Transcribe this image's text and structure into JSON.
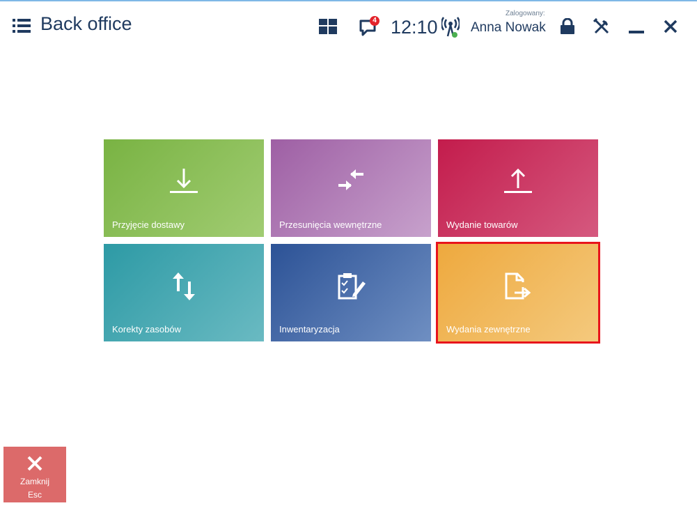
{
  "header": {
    "title": "Back office",
    "notification_count": "4",
    "time": "12:10",
    "logged_caption": "Zalogowany:",
    "user_name": "Anna Nowak"
  },
  "tiles": [
    {
      "label": "Przyjęcie dostawy",
      "icon": "download-arrow-icon",
      "color": "#79b343"
    },
    {
      "label": "Przesunięcia wewnętrzne",
      "icon": "opposite-arrows-icon",
      "color": "#9e5fa4"
    },
    {
      "label": "Wydanie towarów",
      "icon": "upload-arrow-icon",
      "color": "#c31c4c"
    },
    {
      "label": "Korekty zasobów",
      "icon": "up-down-arrows-icon",
      "color": "#2d9aa5"
    },
    {
      "label": "Inwentaryzacja",
      "icon": "clipboard-check-icon",
      "color": "#2c5296"
    },
    {
      "label": "Wydania zewnętrzne",
      "icon": "document-export-icon",
      "color": "#eea93e",
      "selected": true
    }
  ],
  "selection_color": "#e8141c",
  "close_button": {
    "label": "Zamknij",
    "shortcut": "Esc",
    "color": "#dc6a6a"
  }
}
